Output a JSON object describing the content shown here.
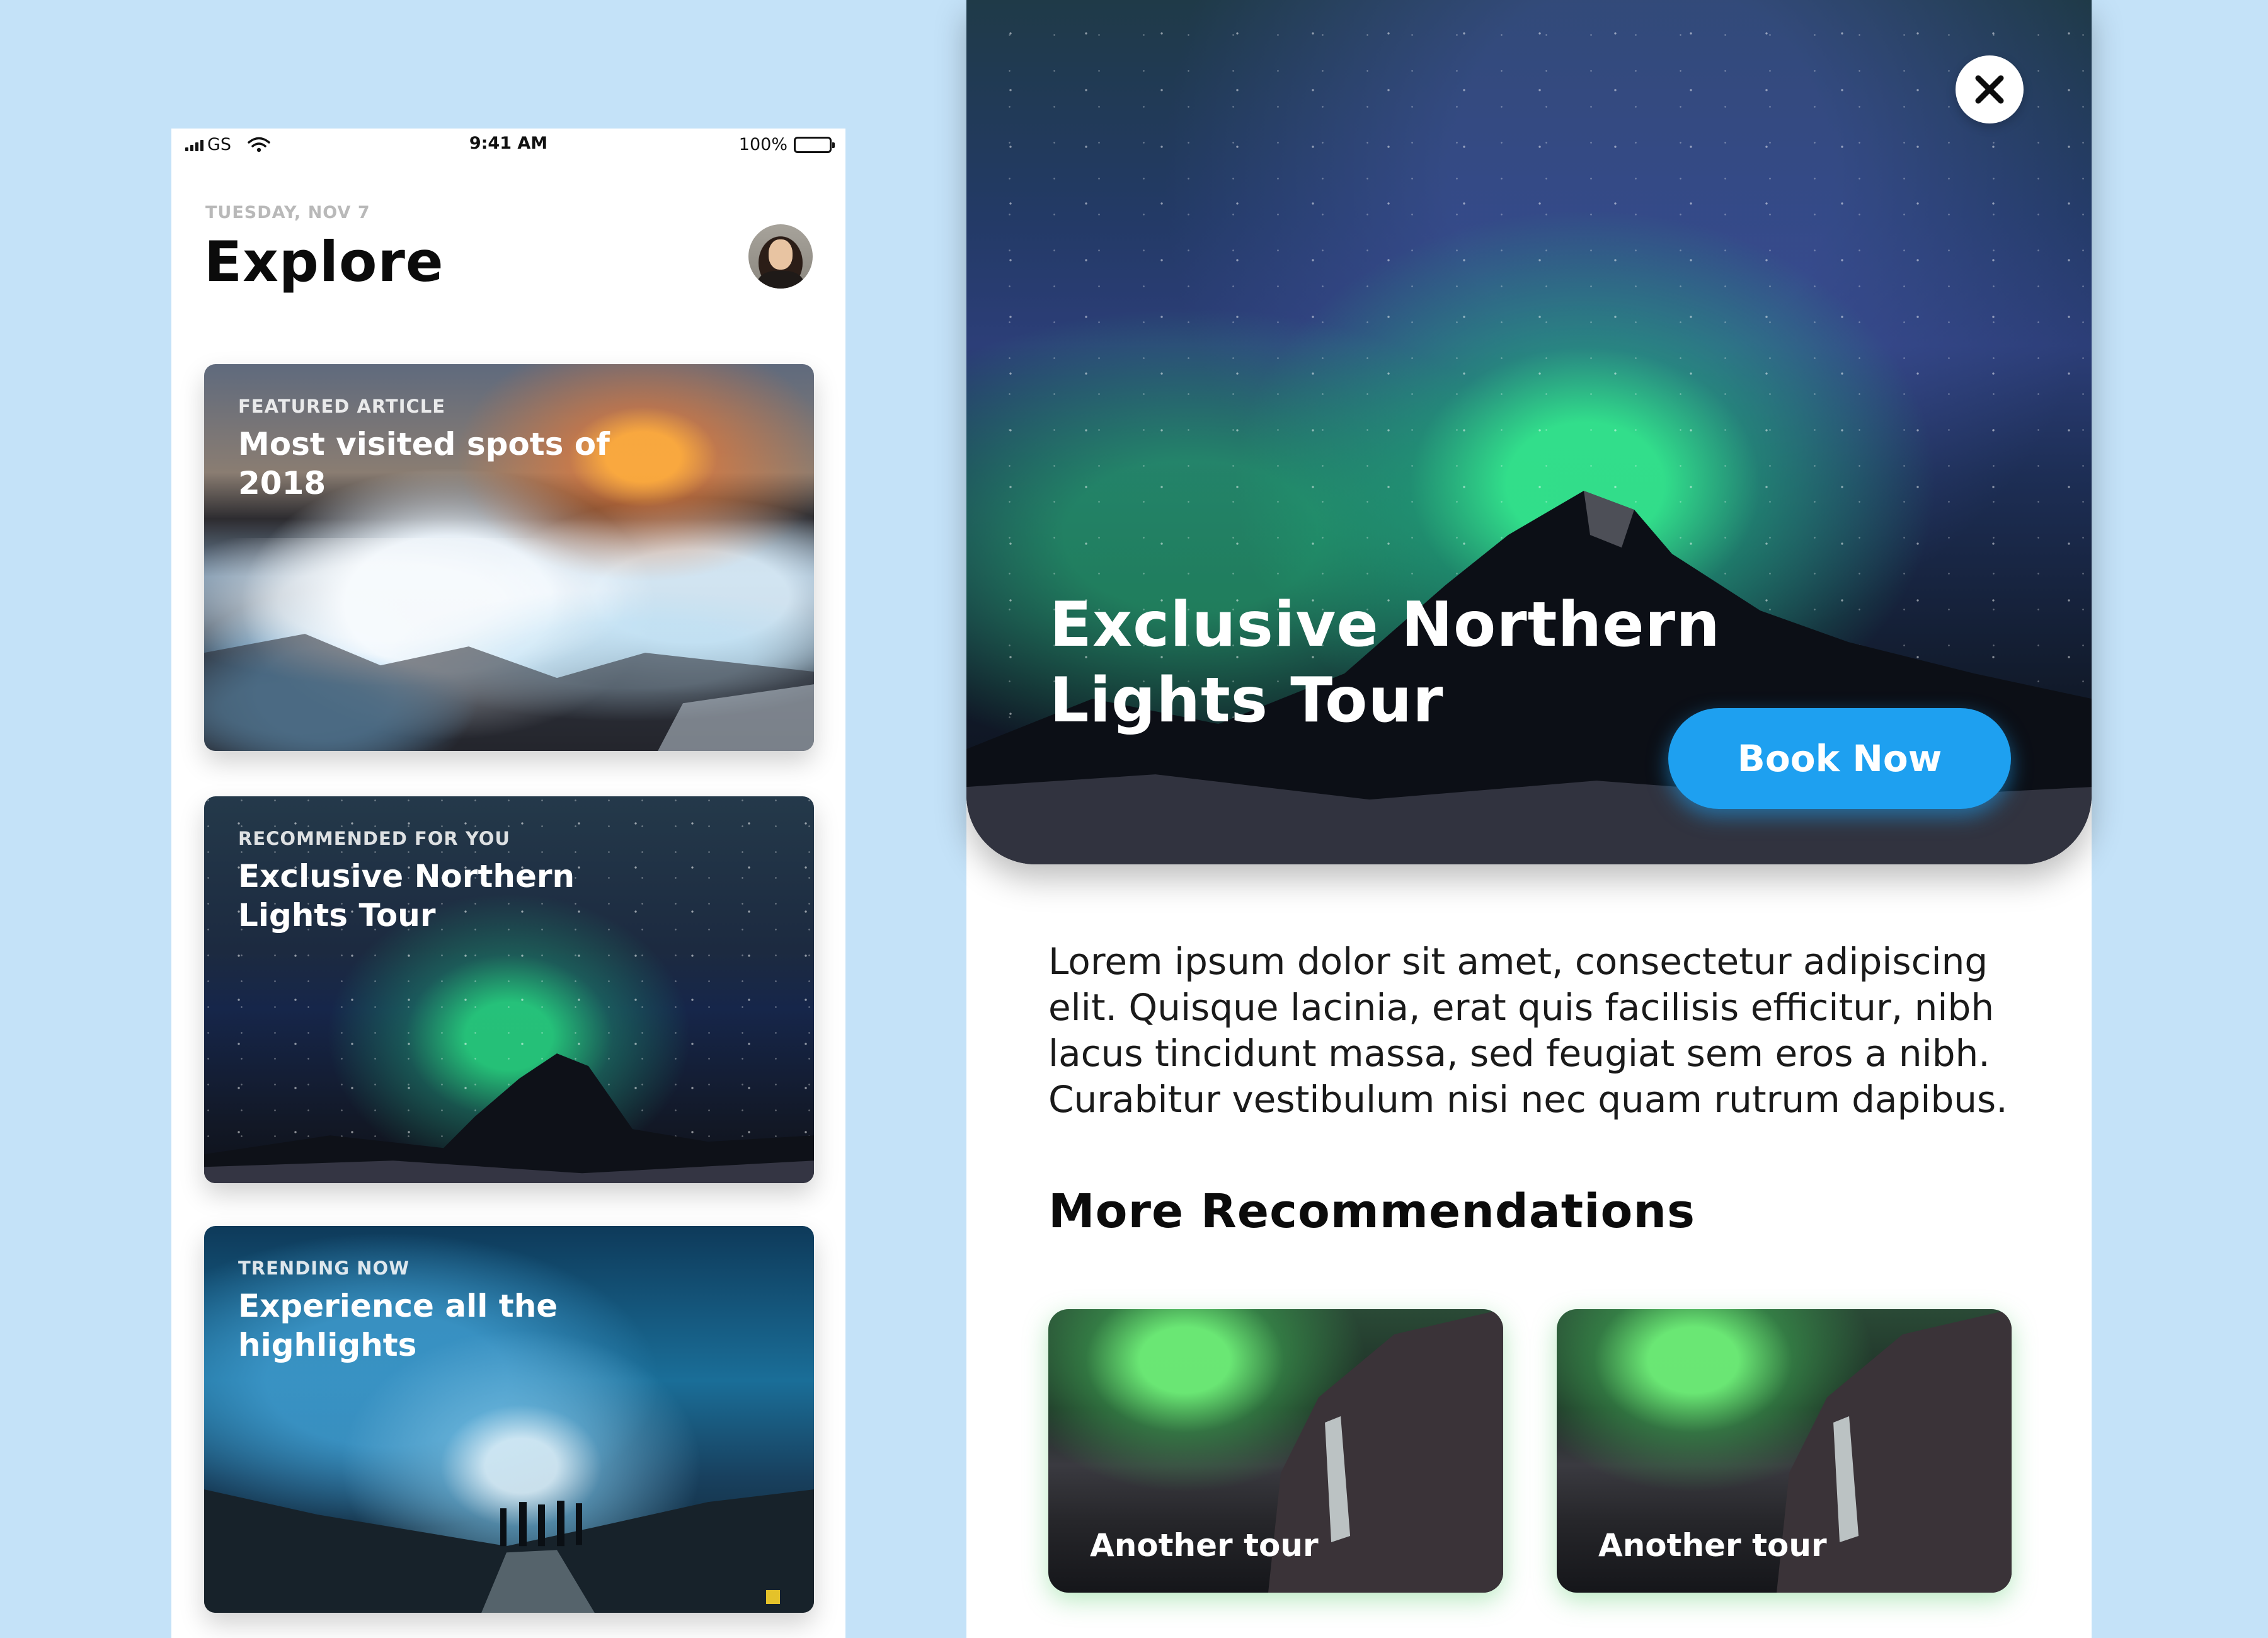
{
  "status_bar": {
    "carrier": "GS",
    "time": "9:41 AM",
    "battery": "100%"
  },
  "explore": {
    "date": "TUESDAY, NOV 7",
    "title": "Explore",
    "cards": [
      {
        "eyebrow": "FEATURED ARTICLE",
        "title": "Most visited spots of 2018"
      },
      {
        "eyebrow": "RECOMMENDED FOR YOU",
        "title": "Exclusive Northern Lights Tour"
      },
      {
        "eyebrow": "TRENDING NOW",
        "title": "Experience all the highlights"
      }
    ]
  },
  "detail": {
    "title": "Exclusive Northern Lights Tour",
    "book_label": "Book Now",
    "description": "Lorem ipsum dolor sit amet, consectetur adipiscing elit. Quisque lacinia, erat quis facilisis efficitur, nibh lacus tincidunt massa, sed feugiat sem eros a nibh. Curabitur vestibulum nisi nec quam rutrum dapibus.",
    "section_title": "More Recommendations",
    "recommendations": [
      {
        "label": "Another tour"
      },
      {
        "label": "Another tour"
      }
    ]
  },
  "colors": {
    "background": "#c4e2f8",
    "accent": "#1ea0f0"
  },
  "icons": {
    "close": "close-icon",
    "signal": "signal-icon",
    "wifi": "wifi-icon",
    "battery": "battery-icon"
  }
}
